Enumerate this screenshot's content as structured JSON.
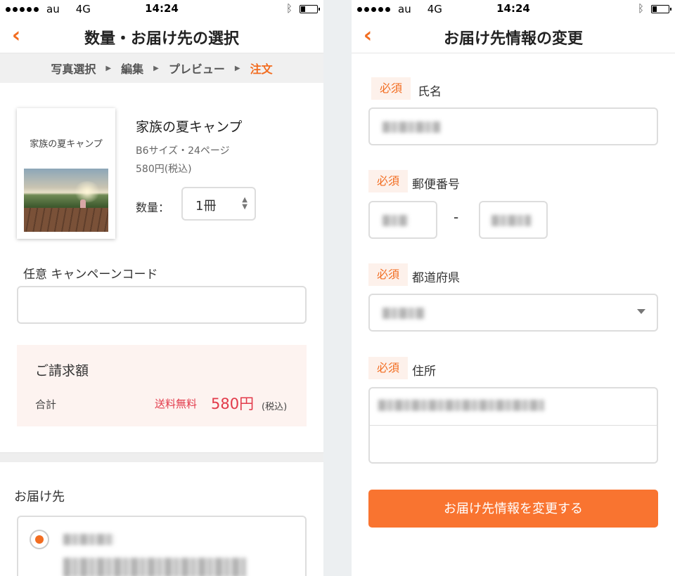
{
  "status_bar": {
    "carrier": "au",
    "network": "4G",
    "time": "14:24",
    "bluetooth_icon": "bluetooth-icon",
    "battery_level": 0.25
  },
  "left_screen": {
    "title": "数量・お届け先の選択",
    "steps": [
      {
        "label": "写真選択"
      },
      {
        "label": "編集"
      },
      {
        "label": "プレビュー"
      },
      {
        "label": "注文",
        "active": true
      }
    ],
    "product": {
      "cover_title": "家族の夏キャンプ",
      "name": "家族の夏キャンプ",
      "spec": "B6サイズ・24ページ",
      "price": "580円(税込)",
      "quantity_label": "数量：",
      "quantity_value": "1冊"
    },
    "campaign": {
      "label": "任意 キャンペーンコード",
      "value": ""
    },
    "bill": {
      "title": "ご請求額",
      "total_label": "合計",
      "shipping": "送料無料",
      "amount": "580円",
      "tax_note": "(税込)"
    },
    "delivery": {
      "title": "お届け先"
    }
  },
  "right_screen": {
    "title": "お届け先情報の変更",
    "required_badge": "必須",
    "fields": {
      "name_label": "氏名",
      "postal_label": "郵便番号",
      "postal_separator": "-",
      "prefecture_label": "都道府県",
      "address_label": "住所"
    },
    "submit_label": "お届け先情報を変更する"
  },
  "colors": {
    "accent": "#f26d21",
    "button": "#f97430",
    "price": "#e23a4a",
    "bill_bg": "#fdf3f0"
  }
}
